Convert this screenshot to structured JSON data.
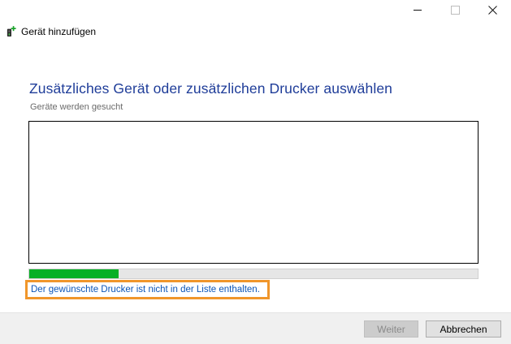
{
  "window": {
    "title": "Gerät hinzufügen",
    "controls": {
      "minimize_icon": "minimize-icon",
      "maximize_icon": "maximize-icon",
      "close_icon": "close-icon"
    }
  },
  "main": {
    "heading": "Zusätzliches Gerät oder zusätzlichen Drucker auswählen",
    "status": "Geräte werden gesucht",
    "devices": [],
    "progress_fraction": 0.2,
    "missing_printer_link": "Der gewünschte Drucker ist nicht in der Liste enthalten."
  },
  "footer": {
    "next_label": "Weiter",
    "cancel_label": "Abbrechen"
  },
  "colors": {
    "heading": "#1f3d99",
    "link": "#0a55b8",
    "progress": "#06b025",
    "highlight": "#f0962b"
  }
}
